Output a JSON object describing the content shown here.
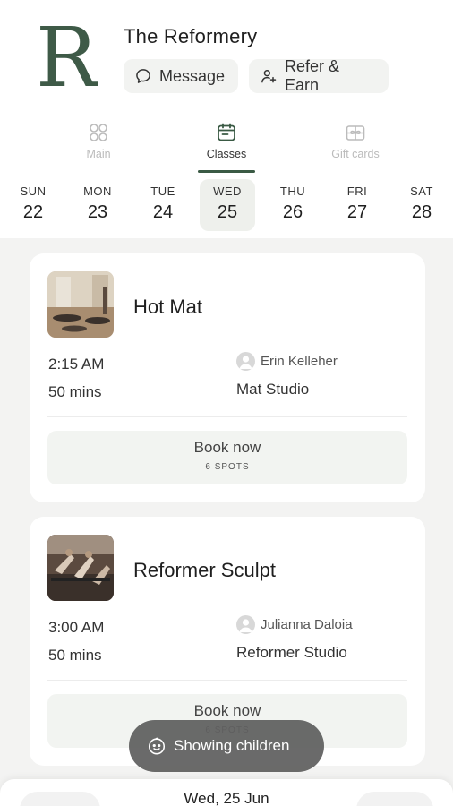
{
  "header": {
    "studio_name": "The Reformery",
    "logo_letter": "R",
    "message_label": "Message",
    "refer_label": "Refer & Earn"
  },
  "tabs": [
    {
      "label": "Main",
      "icon": "grid-icon",
      "active": false
    },
    {
      "label": "Classes",
      "icon": "calendar-icon",
      "active": true
    },
    {
      "label": "Gift cards",
      "icon": "gift-icon",
      "active": false
    }
  ],
  "days": [
    {
      "name": "SUN",
      "date": "22"
    },
    {
      "name": "MON",
      "date": "23"
    },
    {
      "name": "TUE",
      "date": "24"
    },
    {
      "name": "WED",
      "date": "25",
      "selected": true
    },
    {
      "name": "THU",
      "date": "26"
    },
    {
      "name": "FRI",
      "date": "27"
    },
    {
      "name": "SAT",
      "date": "28"
    }
  ],
  "classes": [
    {
      "title": "Hot Mat",
      "time": "2:15 AM",
      "duration": "50 mins",
      "instructor": "Erin Kelleher",
      "room": "Mat Studio",
      "book_label": "Book now",
      "spots": "6 SPOTS"
    },
    {
      "title": "Reformer Sculpt",
      "time": "3:00 AM",
      "duration": "50 mins",
      "instructor": "Julianna Daloia",
      "room": "Reformer Studio",
      "book_label": "Book now",
      "spots": "6 SPOTS"
    }
  ],
  "toast": {
    "label": "Showing children",
    "icon": "child-face-icon"
  },
  "bottom_bar": {
    "date_label": "Wed, 25 Jun"
  },
  "colors": {
    "accent_green": "#3a5a44",
    "list_background": "#f3f3f2",
    "chip_background": "#f2f3f1"
  }
}
